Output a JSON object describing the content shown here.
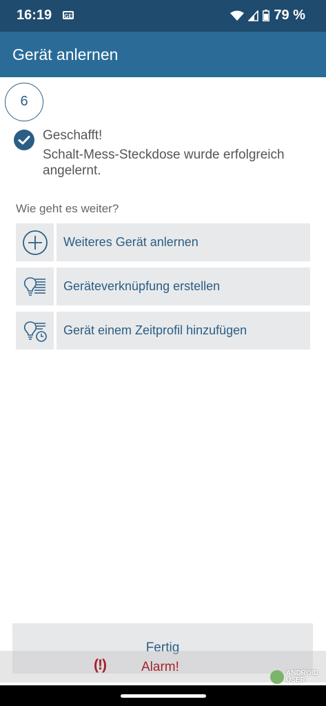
{
  "status_bar": {
    "time": "16:19",
    "notification_icon": "GE",
    "battery": "79 %"
  },
  "app_bar": {
    "title": "Gerät anlernen"
  },
  "step": {
    "number": "6"
  },
  "success": {
    "title": "Geschafft!",
    "message": "Schalt-Mess-Steckdose wurde erfolgreich angelernt."
  },
  "next_steps": {
    "heading": "Wie geht es weiter?",
    "actions": [
      {
        "label": "Weiteres Gerät anlernen",
        "icon": "plus-circle-icon"
      },
      {
        "label": "Geräteverknüpfung erstellen",
        "icon": "bulb-link-icon"
      },
      {
        "label": "Gerät einem Zeitprofil hinzufügen",
        "icon": "bulb-clock-icon"
      }
    ]
  },
  "footer": {
    "done_label": "Fertig"
  },
  "alarm": {
    "icon_text": "(!)",
    "label": "Alarm!"
  },
  "watermark": {
    "line1": "ANDROID",
    "line2": "USER"
  },
  "colors": {
    "app_bar": "#2a6b98",
    "status_bar": "#1f4b6e",
    "accent": "#2a5e84",
    "alarm": "#a3222a"
  }
}
